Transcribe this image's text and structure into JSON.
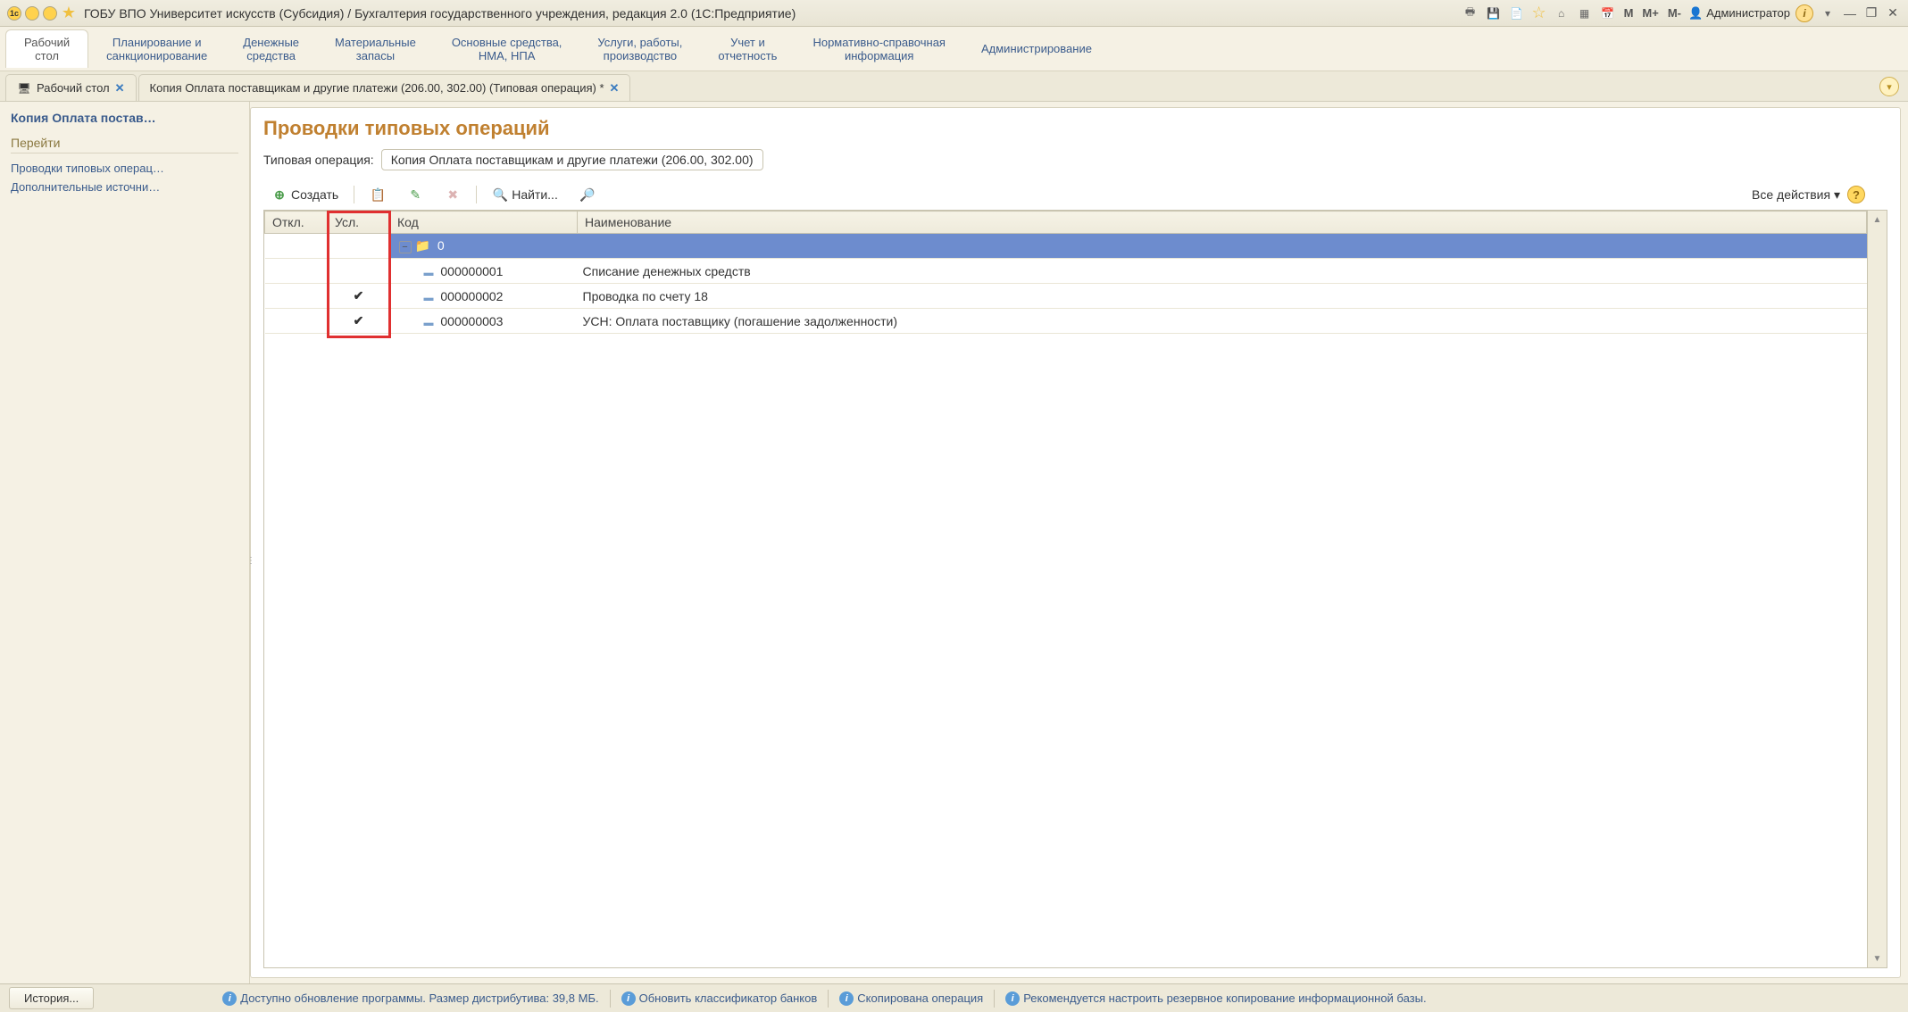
{
  "titlebar": {
    "title": "ГОБУ ВПО Университет искусств (Субсидия) / Бухгалтерия государственного учреждения, редакция 2.0  (1С:Предприятие)",
    "m_labels": [
      "M",
      "M+",
      "M-"
    ],
    "user": "Администратор"
  },
  "sections": [
    {
      "label": "Рабочий\nстол",
      "active": true
    },
    {
      "label": "Планирование и\nсанкционирование"
    },
    {
      "label": "Денежные\nсредства"
    },
    {
      "label": "Материальные\nзапасы"
    },
    {
      "label": "Основные средства,\nНМА, НПА"
    },
    {
      "label": "Услуги, работы,\nпроизводство"
    },
    {
      "label": "Учет и\nотчетность"
    },
    {
      "label": "Нормативно-справочная\nинформация"
    },
    {
      "label": "Администрирование"
    }
  ],
  "tabs": [
    {
      "label": "Рабочий стол",
      "icon": "desktop"
    },
    {
      "label": "Копия Оплата поставщикам и другие платежи (206.00, 302.00) (Типовая операция) *"
    }
  ],
  "sidebar": {
    "title": "Копия Оплата постав…",
    "section": "Перейти",
    "links": [
      "Проводки типовых операц…",
      "Дополнительные источни…"
    ]
  },
  "page": {
    "title": "Проводки типовых операций",
    "field_label": "Типовая операция:",
    "field_value": "Копия Оплата поставщикам и другие платежи (206.00, 302.00)"
  },
  "toolbar": {
    "create": "Создать",
    "find": "Найти...",
    "all_actions": "Все действия ▾"
  },
  "grid": {
    "headers": {
      "off": "Откл.",
      "usl": "Усл.",
      "code": "Код",
      "name": "Наименование"
    },
    "rows": [
      {
        "off": "",
        "usl": "",
        "code": "0",
        "name": "",
        "level": 0,
        "type": "folder",
        "selected": true
      },
      {
        "off": "",
        "usl": "",
        "code": "000000001",
        "name": "Списание денежных средств",
        "level": 1,
        "type": "item"
      },
      {
        "off": "",
        "usl": "✔",
        "code": "000000002",
        "name": "Проводка по счету 18",
        "level": 1,
        "type": "item"
      },
      {
        "off": "",
        "usl": "✔",
        "code": "000000003",
        "name": "УСН: Оплата поставщику (погашение задолженности)",
        "level": 1,
        "type": "item"
      }
    ]
  },
  "statusbar": {
    "history": "История...",
    "msg1": "Доступно обновление программы. Размер дистрибутива: 39,8 МБ.",
    "msg2": "Обновить классификатор банков",
    "msg3": "Скопирована операция",
    "msg4": "Рекомендуется настроить резервное копирование информационной базы."
  }
}
